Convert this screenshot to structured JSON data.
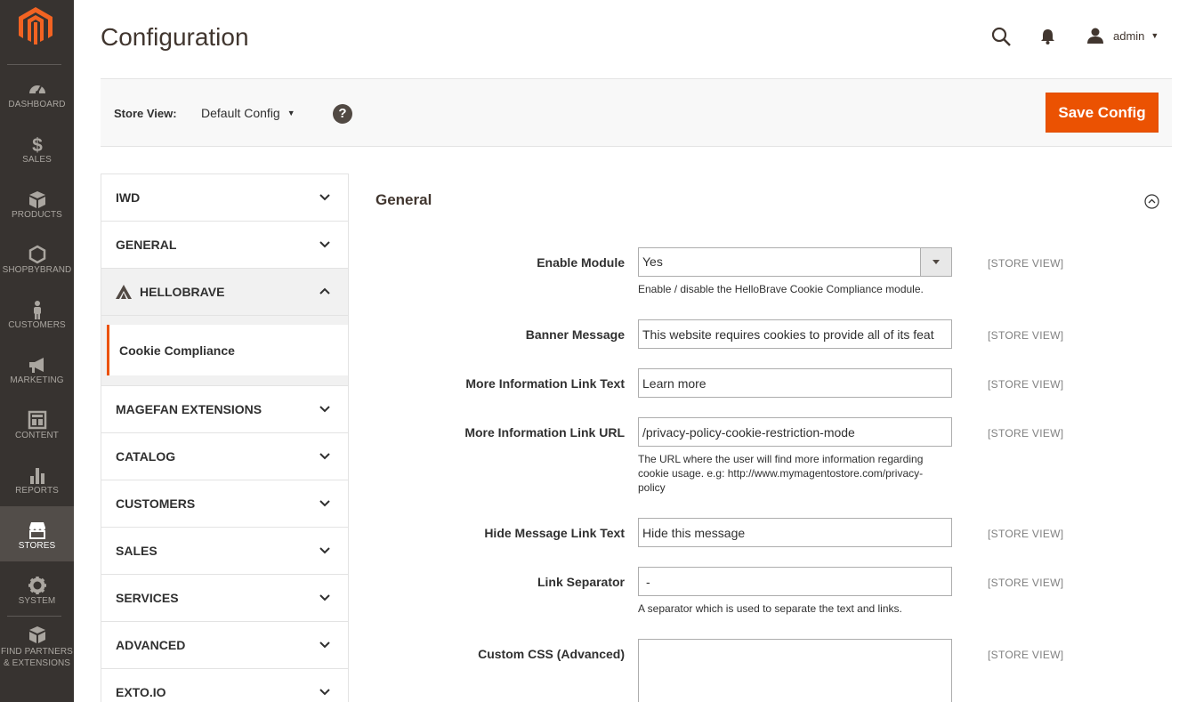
{
  "page_title": "Configuration",
  "header": {
    "search_icon": "search-icon",
    "bell_icon": "bell-icon",
    "user_name": "admin"
  },
  "sidebar": {
    "items": [
      {
        "label": "DASHBOARD",
        "icon": "gauge-icon"
      },
      {
        "label": "SALES",
        "icon": "dollar-icon"
      },
      {
        "label": "PRODUCTS",
        "icon": "cube-icon"
      },
      {
        "label": "SHOPBYBRAND",
        "icon": "hexagon-icon"
      },
      {
        "label": "CUSTOMERS",
        "icon": "person-icon"
      },
      {
        "label": "MARKETING",
        "icon": "megaphone-icon"
      },
      {
        "label": "CONTENT",
        "icon": "layout-icon"
      },
      {
        "label": "REPORTS",
        "icon": "bar-chart-icon"
      },
      {
        "label": "STORES",
        "icon": "store-icon"
      },
      {
        "label": "SYSTEM",
        "icon": "gear-icon"
      },
      {
        "label": "FIND PARTNERS & EXTENSIONS",
        "icon": "boxes-icon"
      }
    ],
    "active": "STORES"
  },
  "store_bar": {
    "label": "Store View:",
    "selected": "Default Config",
    "help": "?",
    "save_label": "Save Config"
  },
  "tabs": {
    "iwd": "IWD",
    "general": "GENERAL",
    "hellobrave": "HELLOBRAVE",
    "hellobrave_sub": "Cookie Compliance",
    "magefan": "MAGEFAN EXTENSIONS",
    "catalog": "CATALOG",
    "customers": "CUSTOMERS",
    "sales": "SALES",
    "services": "SERVICES",
    "advanced": "ADVANCED",
    "exto": "EXTO.IO"
  },
  "section": {
    "title": "General",
    "fields": {
      "enable_module": {
        "label": "Enable Module",
        "value": "Yes",
        "note": "Enable / disable the HelloBrave Cookie Compliance module.",
        "scope": "[STORE VIEW]"
      },
      "banner_message": {
        "label": "Banner Message",
        "value": "This website requires cookies to provide all of its feat",
        "scope": "[STORE VIEW]"
      },
      "more_info_text": {
        "label": "More Information Link Text",
        "value": "Learn more",
        "scope": "[STORE VIEW]"
      },
      "more_info_url": {
        "label": "More Information Link URL",
        "value": "/privacy-policy-cookie-restriction-mode",
        "note": "The URL where the user will find more information regarding cookie usage. e.g: http://www.mymagentostore.com/privacy-policy",
        "scope": "[STORE VIEW]"
      },
      "hide_message_text": {
        "label": "Hide Message Link Text",
        "value": "Hide this message",
        "scope": "[STORE VIEW]"
      },
      "link_separator": {
        "label": "Link Separator",
        "value": "-",
        "note": "A separator which is used to separate the text and links.",
        "scope": "[STORE VIEW]"
      },
      "custom_css": {
        "label": "Custom CSS (Advanced)",
        "value": "",
        "scope": "[STORE VIEW]"
      }
    }
  },
  "colors": {
    "accent": "#eb5202",
    "sidebar": "#373330",
    "sidebar_active": "#524d49"
  }
}
